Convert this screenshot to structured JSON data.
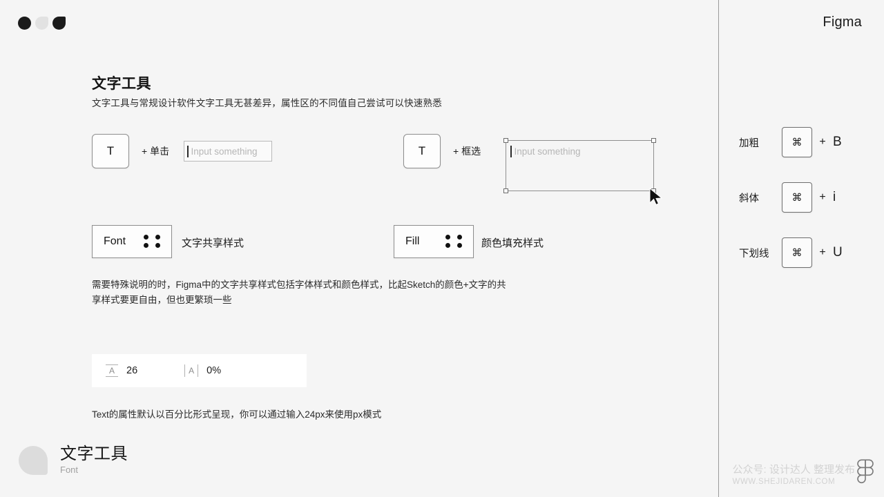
{
  "brand": {
    "name": "Figma"
  },
  "window_dots": [
    {
      "name": "dot-dark",
      "color": "#1b1b1b"
    },
    {
      "name": "dot-light",
      "color": "#e2e2e2"
    },
    {
      "name": "dot-corner",
      "color": "#1b1b1b"
    }
  ],
  "header": {
    "title": "文字工具",
    "subtitle": "文字工具与常规设计软件文字工具无甚差异，属性区的不同值自己尝试可以快速熟悉"
  },
  "demos": [
    {
      "tool_glyph": "T",
      "joiner": "+ 单击",
      "field_placeholder": "Input something",
      "mode": "click"
    },
    {
      "tool_glyph": "T",
      "joiner": "+ 框选",
      "field_placeholder": "Input something",
      "mode": "drag"
    }
  ],
  "style_chips": [
    {
      "label": "Font",
      "note": "文字共享样式",
      "icon": "four-dot-grid-icon"
    },
    {
      "label": "Fill",
      "note": "颜色填充样式",
      "icon": "four-dot-grid-icon"
    }
  ],
  "paragraph": "需要特殊说明的时，Figma中的文字共享样式包括字体样式和颜色样式，比起Sketch的颜色+文字的共享样式要更自由，但也更繁琐一些",
  "properties": {
    "line_height": {
      "icon": "line-height-icon",
      "glyph": "A",
      "value": "26"
    },
    "letter_spacing": {
      "icon": "letter-spacing-icon",
      "glyph": "A",
      "value": "0%"
    }
  },
  "footnote": "Text的属性默认以百分比形式呈现，你可以通过输入24px来使用px模式",
  "shortcuts": [
    {
      "label": "加粗",
      "modifier": "⌘",
      "plus": "+",
      "key": "B"
    },
    {
      "label": "斜体",
      "modifier": "⌘",
      "plus": "+",
      "key": "i"
    },
    {
      "label": "下划线",
      "modifier": "⌘",
      "plus": "+",
      "key": "U"
    }
  ],
  "footer": {
    "title": "文字工具",
    "subtitle": "Font"
  },
  "watermark": {
    "line1": "公众号: 设计达人 整理发布",
    "line2": "WWW.SHEJIDAREN.COM",
    "logo": "figma-logo-icon"
  }
}
